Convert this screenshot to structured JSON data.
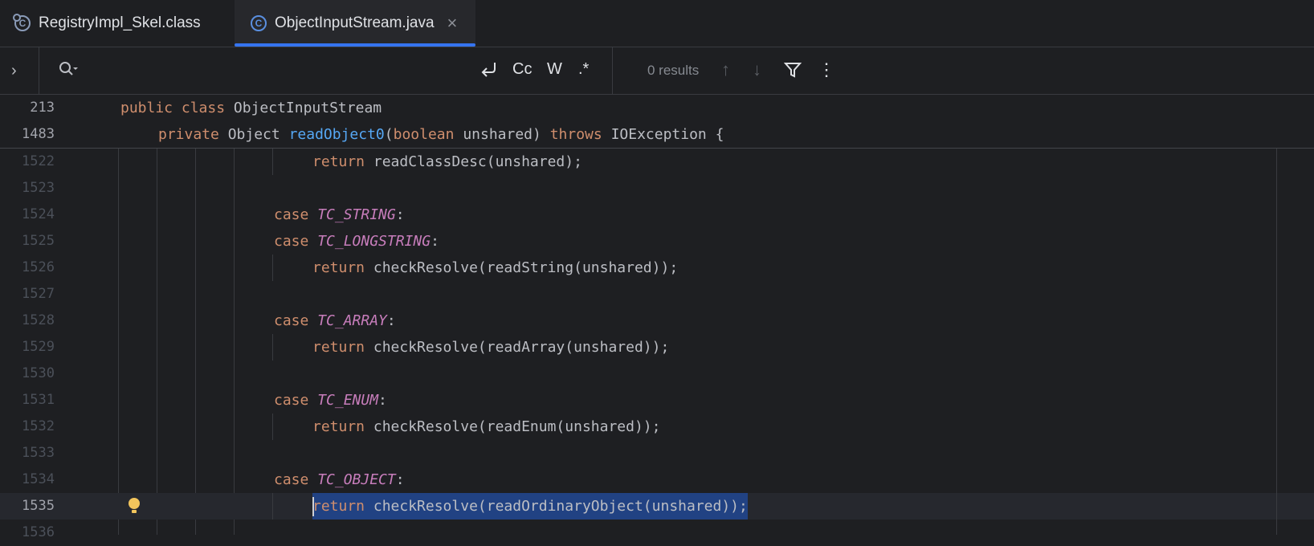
{
  "tabs": [
    {
      "label": "RegistryImpl_Skel.class",
      "icon": "class-file-icon",
      "active": false
    },
    {
      "label": "ObjectInputStream.java",
      "icon": "class-icon",
      "active": true,
      "close": "×"
    }
  ],
  "search": {
    "chevron": "›",
    "search_icon": "search-icon",
    "opt_regex_wrap": "⮐",
    "opt_case": "Cc",
    "opt_words": "W",
    "opt_regex": ".*",
    "results": "0 results",
    "up_icon": "↑",
    "down_icon": "↓",
    "filter_icon": "filter-icon",
    "more_icon": "⋮"
  },
  "sticky_lines": [
    {
      "num": "213",
      "tokens": [
        [
          "kw",
          "public "
        ],
        [
          "kw",
          "class "
        ],
        [
          "pl",
          "ObjectInputStream"
        ]
      ]
    },
    {
      "num": "1483",
      "tokens": [
        [
          "kw",
          "private "
        ],
        [
          "pl",
          "Object "
        ],
        [
          "fn",
          "readObject0"
        ],
        [
          "pl",
          "("
        ],
        [
          "kw",
          "boolean "
        ],
        [
          "pl",
          "unshared) "
        ],
        [
          "kw",
          "throws "
        ],
        [
          "pl",
          "IOException {"
        ]
      ]
    }
  ],
  "lines": [
    {
      "num": "1522",
      "indent": 4,
      "tokens": [
        [
          "kw",
          "return "
        ],
        [
          "pl",
          "readClassDesc(unshared);"
        ]
      ]
    },
    {
      "num": "1523",
      "indent": 0,
      "tokens": []
    },
    {
      "num": "1524",
      "indent": 3,
      "tokens": [
        [
          "kw",
          "case "
        ],
        [
          "cst",
          "TC_STRING"
        ],
        [
          "pl",
          ":"
        ]
      ]
    },
    {
      "num": "1525",
      "indent": 3,
      "tokens": [
        [
          "kw",
          "case "
        ],
        [
          "cst",
          "TC_LONGSTRING"
        ],
        [
          "pl",
          ":"
        ]
      ]
    },
    {
      "num": "1526",
      "indent": 4,
      "tokens": [
        [
          "kw",
          "return "
        ],
        [
          "pl",
          "checkResolve(readString(unshared));"
        ]
      ]
    },
    {
      "num": "1527",
      "indent": 0,
      "tokens": []
    },
    {
      "num": "1528",
      "indent": 3,
      "tokens": [
        [
          "kw",
          "case "
        ],
        [
          "cst",
          "TC_ARRAY"
        ],
        [
          "pl",
          ":"
        ]
      ]
    },
    {
      "num": "1529",
      "indent": 4,
      "tokens": [
        [
          "kw",
          "return "
        ],
        [
          "pl",
          "checkResolve(readArray(unshared));"
        ]
      ]
    },
    {
      "num": "1530",
      "indent": 0,
      "tokens": []
    },
    {
      "num": "1531",
      "indent": 3,
      "tokens": [
        [
          "kw",
          "case "
        ],
        [
          "cst",
          "TC_ENUM"
        ],
        [
          "pl",
          ":"
        ]
      ]
    },
    {
      "num": "1532",
      "indent": 4,
      "tokens": [
        [
          "kw",
          "return "
        ],
        [
          "pl",
          "checkResolve(readEnum(unshared));"
        ]
      ]
    },
    {
      "num": "1533",
      "indent": 0,
      "tokens": []
    },
    {
      "num": "1534",
      "indent": 3,
      "tokens": [
        [
          "kw",
          "case "
        ],
        [
          "cst",
          "TC_OBJECT"
        ],
        [
          "pl",
          ":"
        ]
      ]
    },
    {
      "num": "1535",
      "indent": 4,
      "current": true,
      "selected": true,
      "tokens": [
        [
          "kw",
          "return "
        ],
        [
          "pl",
          "checkResolve(readOrdinaryObject(unshared));"
        ]
      ]
    },
    {
      "num": "1536",
      "indent": 0,
      "tokens": []
    }
  ]
}
